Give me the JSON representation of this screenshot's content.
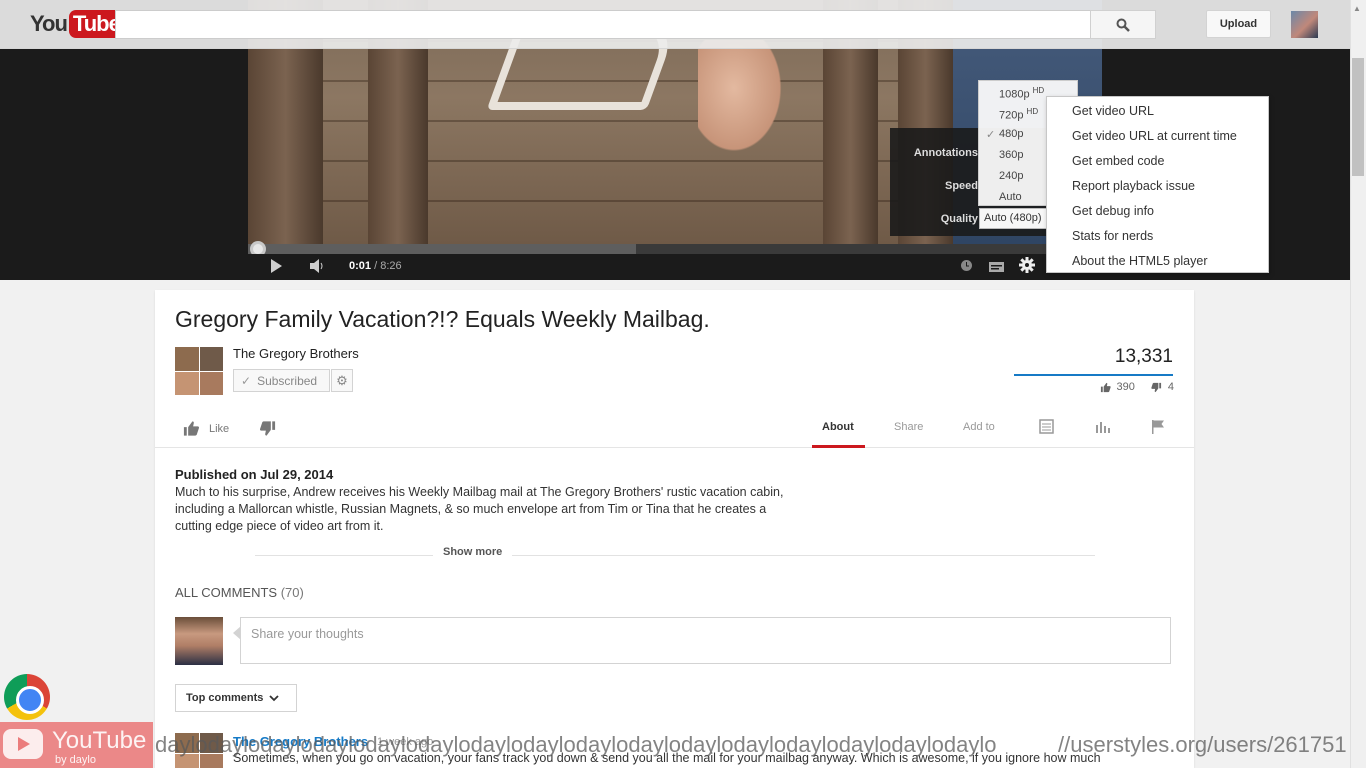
{
  "header": {
    "logo_you": "You",
    "logo_tube": "Tube",
    "search_placeholder": "",
    "upload_label": "Upload"
  },
  "player": {
    "current_time": "0:01",
    "duration": "/ 8:26",
    "progress_fraction": 0.002,
    "buffered_fraction": 0.45,
    "settings": {
      "annotations_label": "Annotations",
      "speed_label": "Speed",
      "quality_label": "Quality",
      "quality_current": "Auto (480p)"
    },
    "quality_options": [
      {
        "label": "1080p",
        "hd": "HD",
        "selected": false
      },
      {
        "label": "720p",
        "hd": "HD",
        "selected": false
      },
      {
        "label": "480p",
        "hd": "",
        "selected": true
      },
      {
        "label": "360p",
        "hd": "",
        "selected": false
      },
      {
        "label": "240p",
        "hd": "",
        "selected": false
      },
      {
        "label": "Auto",
        "hd": "",
        "selected": false
      }
    ],
    "context_menu": [
      "Get video URL",
      "Get video URL at current time",
      "Get embed code",
      "Report playback issue",
      "Get debug info",
      "Stats for nerds",
      "About the HTML5 player"
    ]
  },
  "video": {
    "title": "Gregory Family Vacation?!? Equals Weekly Mailbag.",
    "channel": "The Gregory Brothers",
    "subscribed_label": "Subscribed",
    "views": "13,331",
    "likes": "390",
    "dislikes": "4",
    "like_label": "Like"
  },
  "tabs": {
    "about": "About",
    "share": "Share",
    "add_to": "Add to"
  },
  "description": {
    "published": "Published on Jul 29, 2014",
    "text": "Much to his surprise, Andrew receives his Weekly Mailbag mail at The Gregory Brothers' rustic vacation cabin, including a Mallorcan whistle, Russian Magnets, & so much envelope art from Tim or Tina that he creates a cutting edge piece of video art from it.",
    "show_more": "Show more"
  },
  "comments": {
    "heading": "ALL COMMENTS",
    "count": "(70)",
    "placeholder": "Share your thoughts",
    "sort_label": "Top comments",
    "first": {
      "author": "The Gregory Brothers",
      "time": "1 week ago",
      "text": "Sometimes, when you go on vacation, your fans track you down & send you all the mail for your mailbag anyway.  Which is awesome, if you ignore how much"
    }
  },
  "overlay": {
    "badge_title": "YouTube",
    "badge_by": "by daylo",
    "strip": "daylodaylodaylodaylodaylodaylodaylodaylodaylodaylodaylodaylodaylodaylodaylodaylo",
    "userstyles": "//userstyles.org/users/261751"
  },
  "colors": {
    "brand_red": "#cc181e",
    "link_blue": "#167ac6"
  }
}
